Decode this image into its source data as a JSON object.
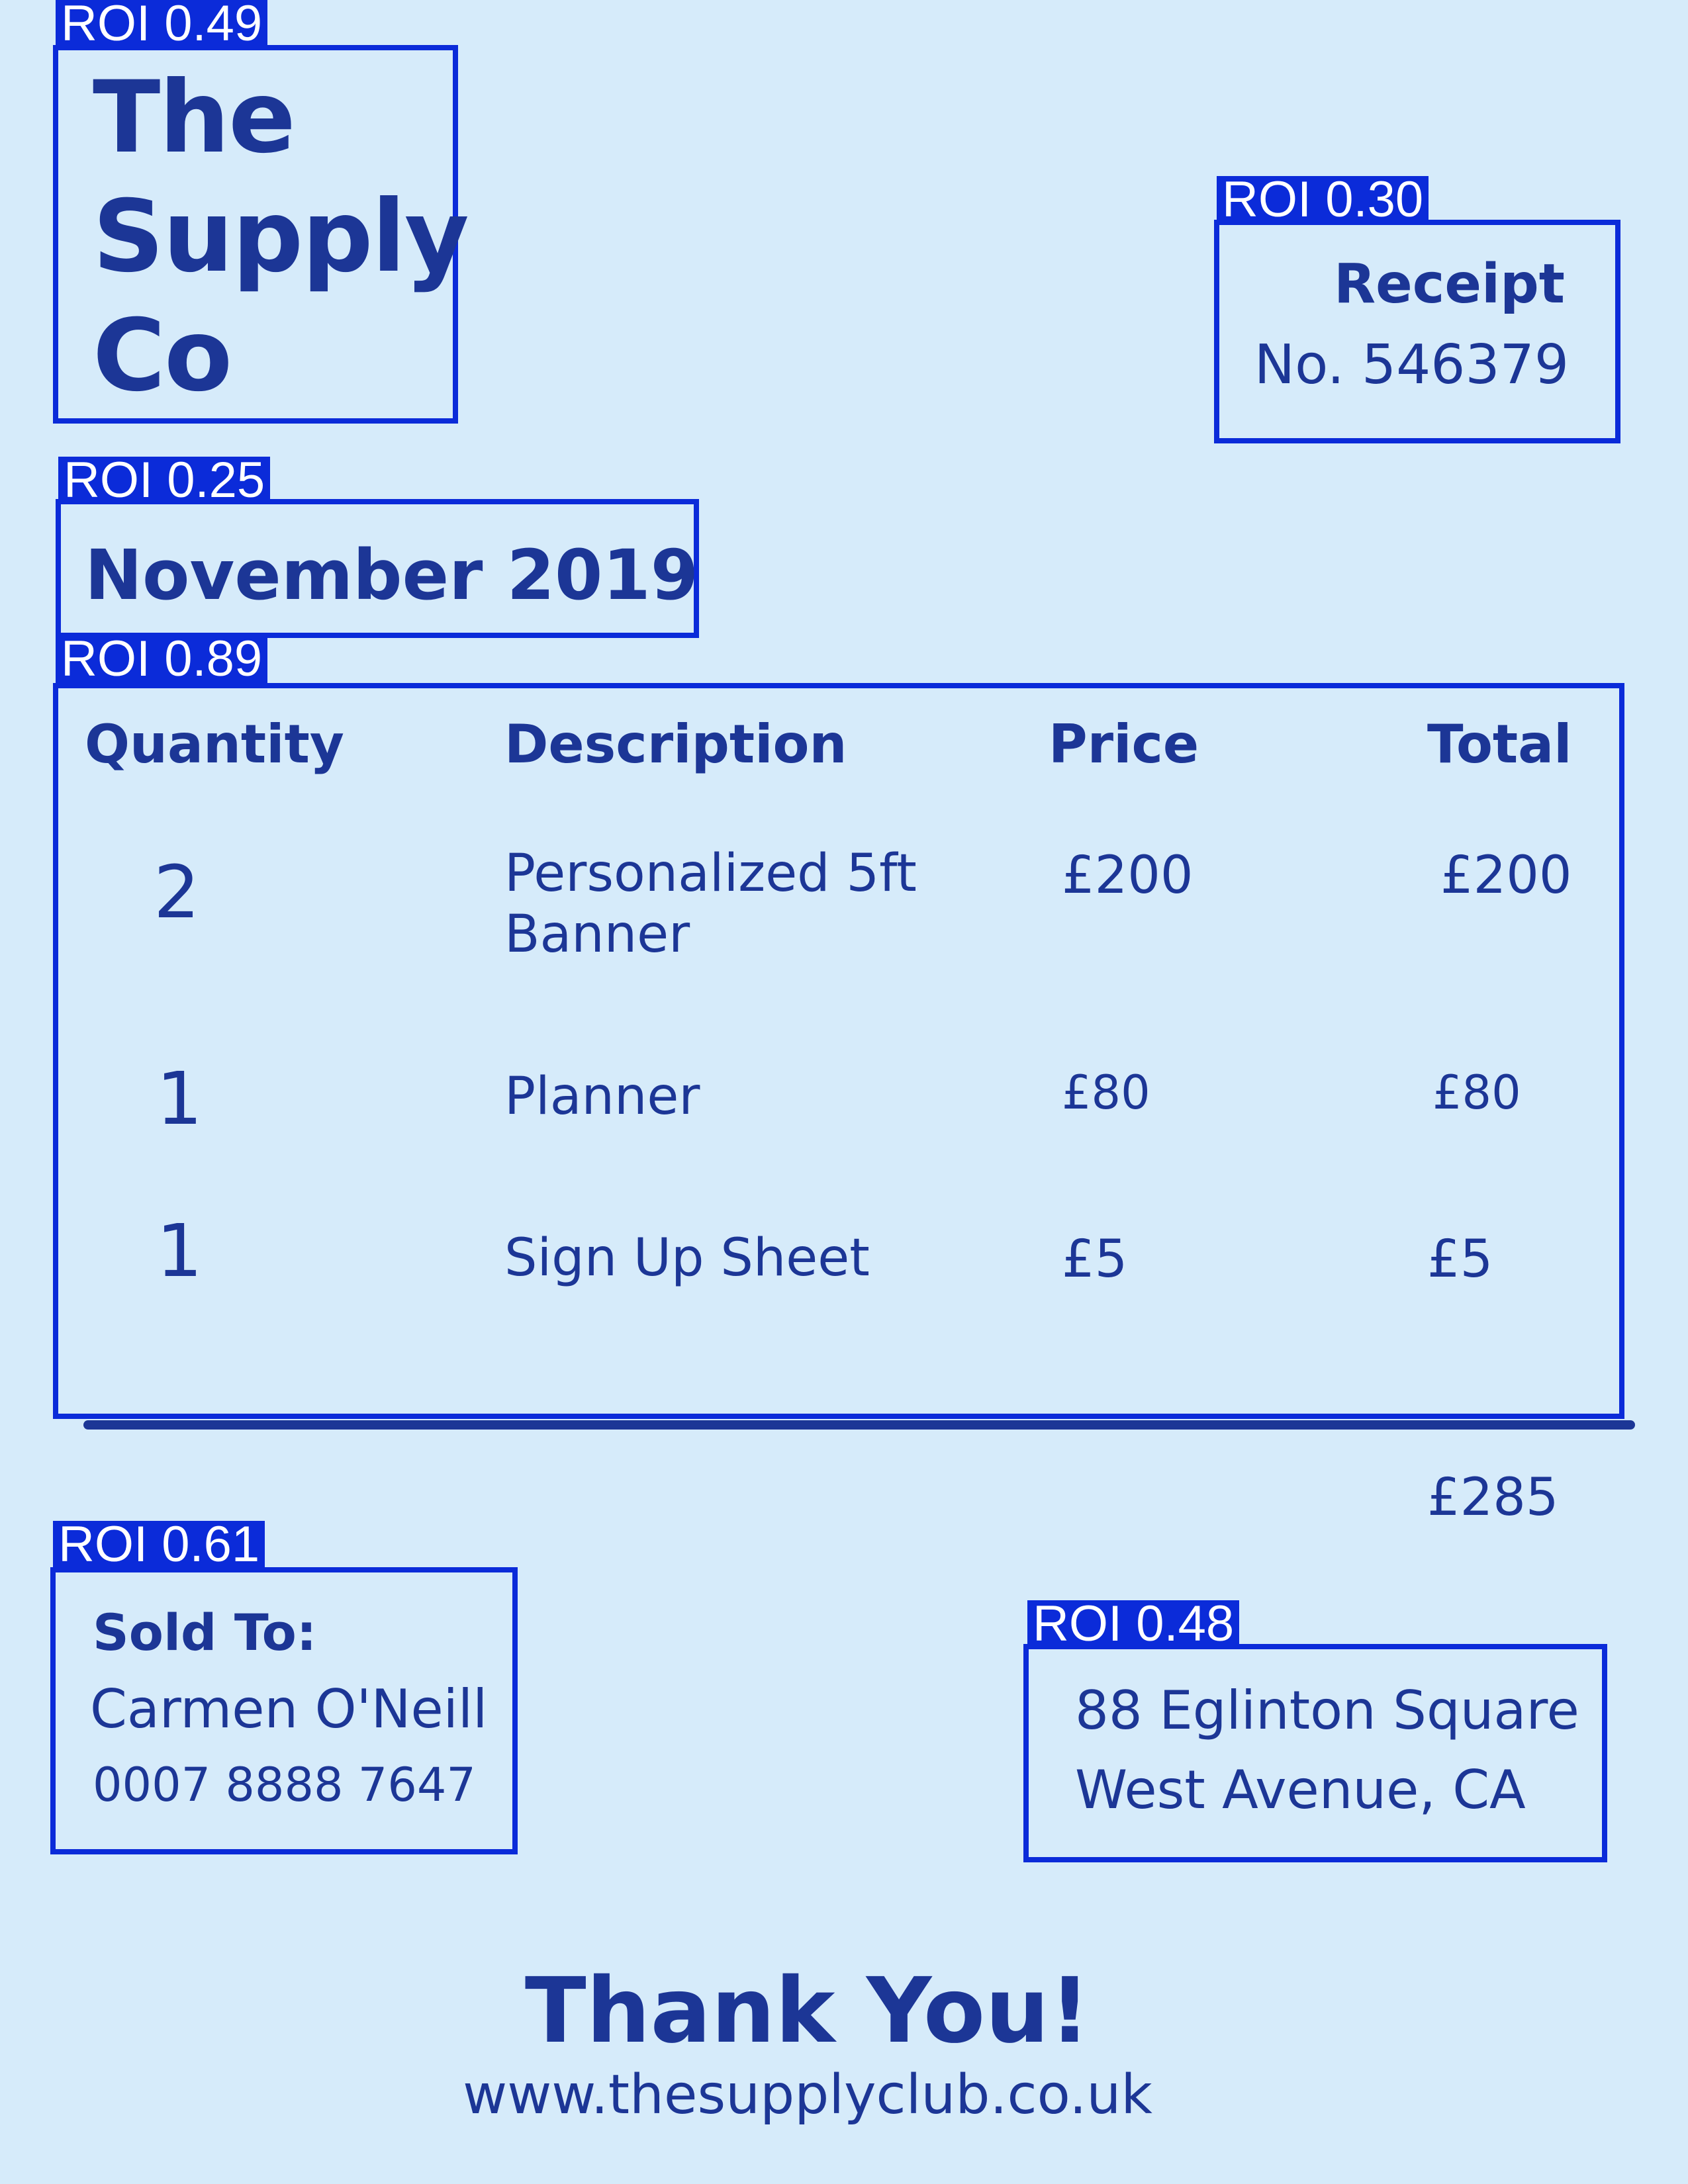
{
  "colors": {
    "background": "#d6ebfa",
    "text": "#1c3696",
    "annotation": "#0b2bd9"
  },
  "annotations": {
    "brand_score": "ROI 0.49",
    "receipt_score": "ROI 0.30",
    "date_score": "ROI 0.25",
    "table_score": "ROI 0.89",
    "sold_score": "ROI 0.61",
    "address_score": "ROI 0.48"
  },
  "brand": {
    "line1": "The",
    "line2": "Supply",
    "line3": "Co"
  },
  "receipt": {
    "title": "Receipt",
    "number": "No. 546379"
  },
  "date": "November 2019",
  "table": {
    "headers": {
      "quantity": "Quantity",
      "description": "Description",
      "price": "Price",
      "total": "Total"
    },
    "rows": [
      {
        "quantity": "2",
        "description_line1": "Personalized 5ft",
        "description_line2": "Banner",
        "price": "£200",
        "total": "£200"
      },
      {
        "quantity": "1",
        "description_line1": "Planner",
        "price": "£80",
        "total": "£80"
      },
      {
        "quantity": "1",
        "description_line1": "Sign Up Sheet",
        "price": "£5",
        "total": "£5"
      }
    ],
    "grand_total": "£285"
  },
  "sold_to": {
    "label": "Sold To:",
    "name": "Carmen O'Neill",
    "phone": "0007 8888 7647"
  },
  "address": {
    "line1": "88 Eglinton Square",
    "line2": "West Avenue, CA"
  },
  "footer": {
    "thanks": "Thank You!",
    "website": "www.thesupplyclub.co.uk"
  }
}
